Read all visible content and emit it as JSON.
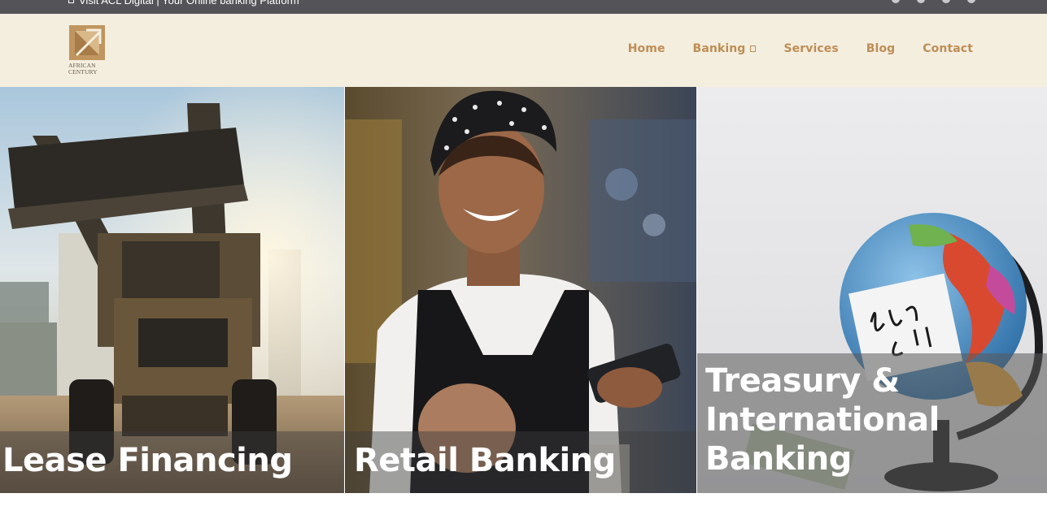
{
  "topbar": {
    "message": "Visit ACL Digital | Your Online banking Platform",
    "social_icons": [
      "facebook-icon",
      "twitter-icon",
      "linkedin-icon",
      "instagram-icon"
    ]
  },
  "brand": {
    "line1": "AFRICAN",
    "line2": "CENTURY",
    "color": "#c0955f"
  },
  "nav": {
    "items": [
      {
        "label": "Home"
      },
      {
        "label": "Banking"
      },
      {
        "label": "Services"
      },
      {
        "label": "Blog"
      },
      {
        "label": "Contact"
      }
    ],
    "color": "#be8d55"
  },
  "panels": [
    {
      "title": "Lease Financing",
      "image": "excavator-photo"
    },
    {
      "title": "Retail Banking",
      "image": "cashier-photo"
    },
    {
      "title_lines": [
        "Treasury &",
        "International",
        "Banking"
      ],
      "image": "globe-photo"
    }
  ]
}
